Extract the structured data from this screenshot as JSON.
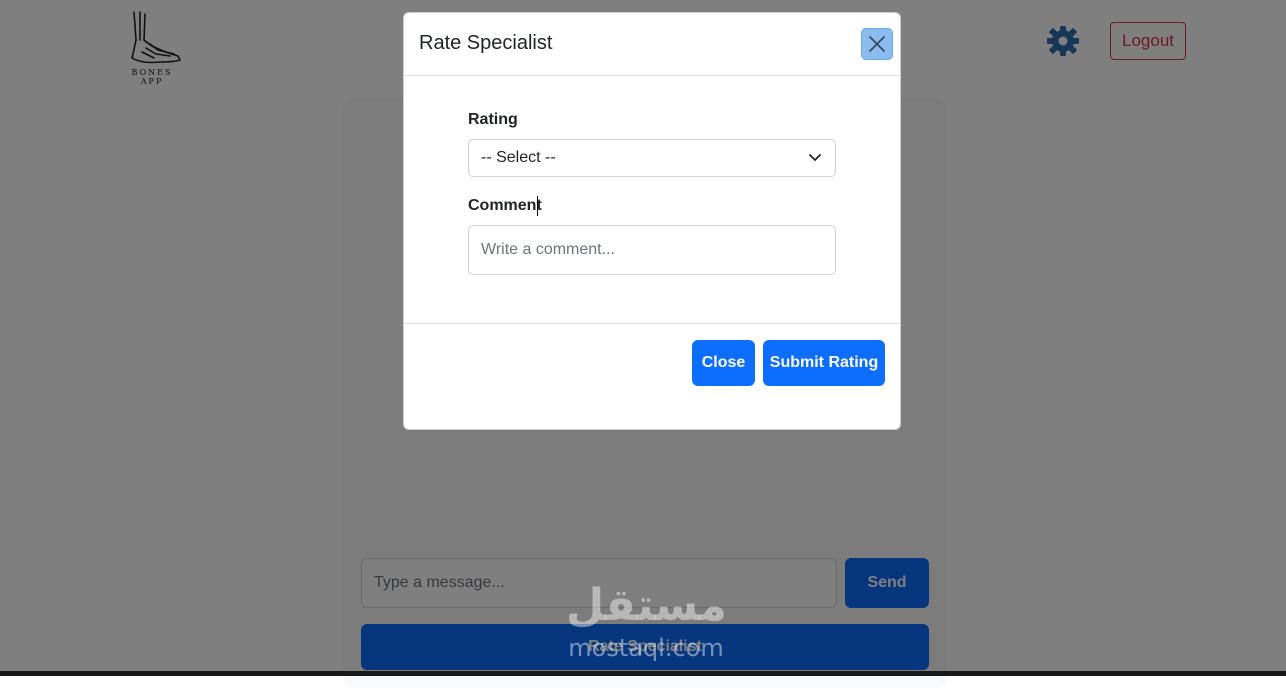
{
  "navbar": {
    "logo_text": "BONES APP",
    "logout_label": "Logout"
  },
  "chat": {
    "message_placeholder": "Type a message...",
    "send_label": "Send",
    "rate_button_label": "Rate Specialist"
  },
  "modal": {
    "title": "Rate Specialist",
    "rating_label": "Rating",
    "rating_selected": "-- Select --",
    "comment_label": "Comment",
    "comment_placeholder": "Write a comment...",
    "close_label": "Close",
    "submit_label": "Submit Rating"
  },
  "watermark": {
    "arabic": "مستقل",
    "latin": "mostaql.com"
  },
  "colors": {
    "primary": "#0d6efd",
    "danger": "#dc3545",
    "backdrop": "rgba(0,0,0,0.5)"
  },
  "icons": [
    "foot-skeleton-icon",
    "gear-icon",
    "close-icon",
    "chevron-down-icon"
  ]
}
